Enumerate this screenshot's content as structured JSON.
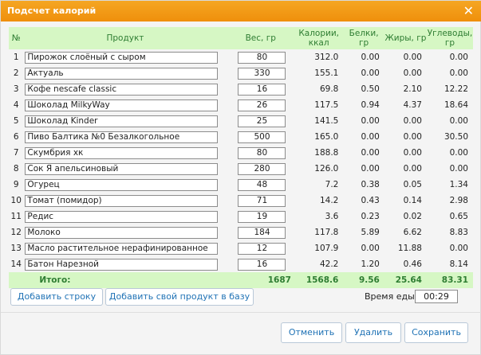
{
  "dialog": {
    "title": "Подсчет калорий",
    "close_icon": "close-icon"
  },
  "table": {
    "headers": {
      "num": "№",
      "product": "Продукт",
      "weight": "Вес, гр",
      "kcal_line1": "Калории,",
      "kcal_line2": "ккал",
      "protein": "Белки, гр",
      "fat": "Жиры, гр",
      "carbs_line1": "Углеводы,",
      "carbs_line2": "гр"
    },
    "rows": [
      {
        "num": "1",
        "product": "Пирожок слоёный с сыром",
        "weight": "80",
        "kcal": "312.0",
        "protein": "0.00",
        "fat": "0.00",
        "carbs": "0.00"
      },
      {
        "num": "2",
        "product": "Актуаль",
        "weight": "330",
        "kcal": "155.1",
        "protein": "0.00",
        "fat": "0.00",
        "carbs": "0.00"
      },
      {
        "num": "3",
        "product": "Кофе nescafe classic",
        "weight": "16",
        "kcal": "69.8",
        "protein": "0.50",
        "fat": "2.10",
        "carbs": "12.22"
      },
      {
        "num": "4",
        "product": "Шоколад MilkyWay",
        "weight": "26",
        "kcal": "117.5",
        "protein": "0.94",
        "fat": "4.37",
        "carbs": "18.64"
      },
      {
        "num": "5",
        "product": "Шоколад Kinder",
        "weight": "25",
        "kcal": "141.5",
        "protein": "0.00",
        "fat": "0.00",
        "carbs": "0.00"
      },
      {
        "num": "6",
        "product": "Пиво Балтика №0 Безалкогольное",
        "weight": "500",
        "kcal": "165.0",
        "protein": "0.00",
        "fat": "0.00",
        "carbs": "30.50"
      },
      {
        "num": "7",
        "product": "Скумбрия хк",
        "weight": "80",
        "kcal": "188.8",
        "protein": "0.00",
        "fat": "0.00",
        "carbs": "0.00"
      },
      {
        "num": "8",
        "product": "Сок Я апельсиновый",
        "weight": "280",
        "kcal": "126.0",
        "protein": "0.00",
        "fat": "0.00",
        "carbs": "0.00"
      },
      {
        "num": "9",
        "product": "Огурец",
        "weight": "48",
        "kcal": "7.2",
        "protein": "0.38",
        "fat": "0.05",
        "carbs": "1.34"
      },
      {
        "num": "10",
        "product": "Томат (помидор)",
        "weight": "71",
        "kcal": "14.2",
        "protein": "0.43",
        "fat": "0.14",
        "carbs": "2.98"
      },
      {
        "num": "11",
        "product": "Редис",
        "weight": "19",
        "kcal": "3.6",
        "protein": "0.23",
        "fat": "0.02",
        "carbs": "0.65"
      },
      {
        "num": "12",
        "product": "Молоко",
        "weight": "184",
        "kcal": "117.8",
        "protein": "5.89",
        "fat": "6.62",
        "carbs": "8.83"
      },
      {
        "num": "13",
        "product": "Масло растительное нерафинированное",
        "weight": "12",
        "kcal": "107.9",
        "protein": "0.00",
        "fat": "11.88",
        "carbs": "0.00"
      },
      {
        "num": "14",
        "product": "Батон Нарезной",
        "weight": "16",
        "kcal": "42.2",
        "protein": "1.20",
        "fat": "0.46",
        "carbs": "8.14"
      }
    ],
    "total": {
      "label": "Итого:",
      "weight": "1687",
      "kcal": "1568.6",
      "protein": "9.56",
      "fat": "25.64",
      "carbs": "83.31"
    }
  },
  "actions": {
    "add_row": "Добавить строку",
    "add_product": "Добавить свой продукт в базу",
    "meal_time_label": "Время еды:",
    "meal_time_value": "00:29",
    "cancel": "Отменить",
    "delete": "Удалить",
    "save": "Сохранить"
  },
  "colors": {
    "titlebar": "#f39c12",
    "header_bg": "#d6f7c4",
    "header_text": "#2e7d32",
    "button_text": "#1f72b5"
  }
}
